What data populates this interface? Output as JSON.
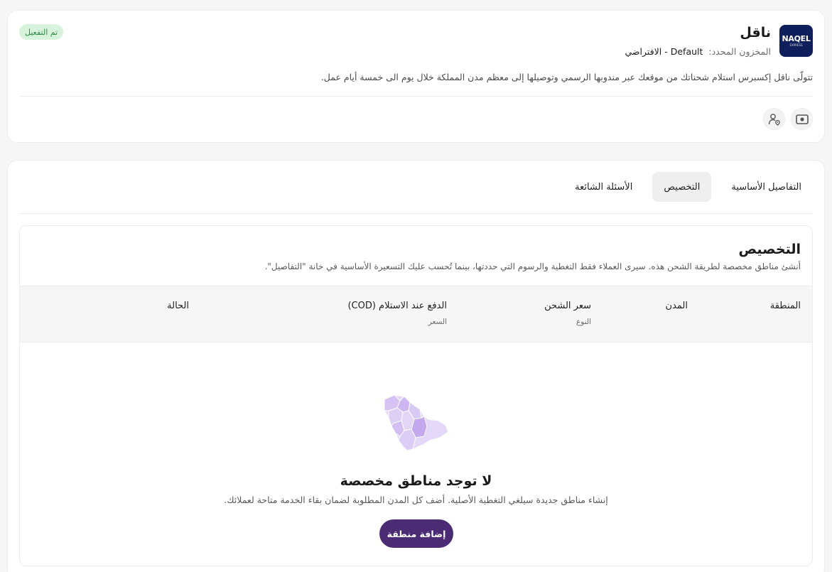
{
  "carrier": {
    "logo_text": "NAQEL",
    "logo_subtext": "EXPRESS",
    "name": "ناقل",
    "warehouse_label": "المخزون المحدد:",
    "warehouse_value": "Default - الافتراضي",
    "status_badge": "تم التفعيل",
    "description": "تتولّى ناقل إكسبرس استلام شحناتك من موقعك عبر مندوبها الرسمي وتوصيلها إلى معظم مدن المملكة خلال يوم الى خمسة أيام عمل.",
    "icons": [
      "cash-icon",
      "user-location-icon"
    ]
  },
  "tabs": [
    {
      "label": "التفاصيل الأساسية",
      "active": false
    },
    {
      "label": "التخصيص",
      "active": true
    },
    {
      "label": "الأسئلة الشائعة",
      "active": false
    }
  ],
  "customization": {
    "title": "التخصيص",
    "subtitle": "أنشئ مناطق مخصصة لطريقة الشحن هذه. سيرى العملاء فقط التغطية والرسوم التي حددتها، بينما تُحسب عليك التسعيرة الأساسية في خانة \"التفاصيل\".",
    "columns": {
      "region": "المنطقة",
      "cities": "المدن",
      "shipping_price": "سعر الشحن",
      "shipping_price_sub": "النوع",
      "cod": "الدفع عند الاستلام (COD)",
      "cod_sub": "السعر",
      "status": "الحالة"
    },
    "empty": {
      "title": "لا توجد مناطق مخصصة",
      "description": "إنشاء مناطق جديدة سيلغي التغطية الأصلية. أضف كل المدن المطلوبة لضمان بقاء الخدمة متاحة لعملائك.",
      "button": "إضافة منطقة"
    }
  },
  "colors": {
    "primary": "#4b2b73",
    "badge_bg": "#d8f3dc",
    "badge_text": "#2f8a48",
    "logo_bg": "#0f1f5c",
    "map_fill": "#d9c9f5"
  }
}
